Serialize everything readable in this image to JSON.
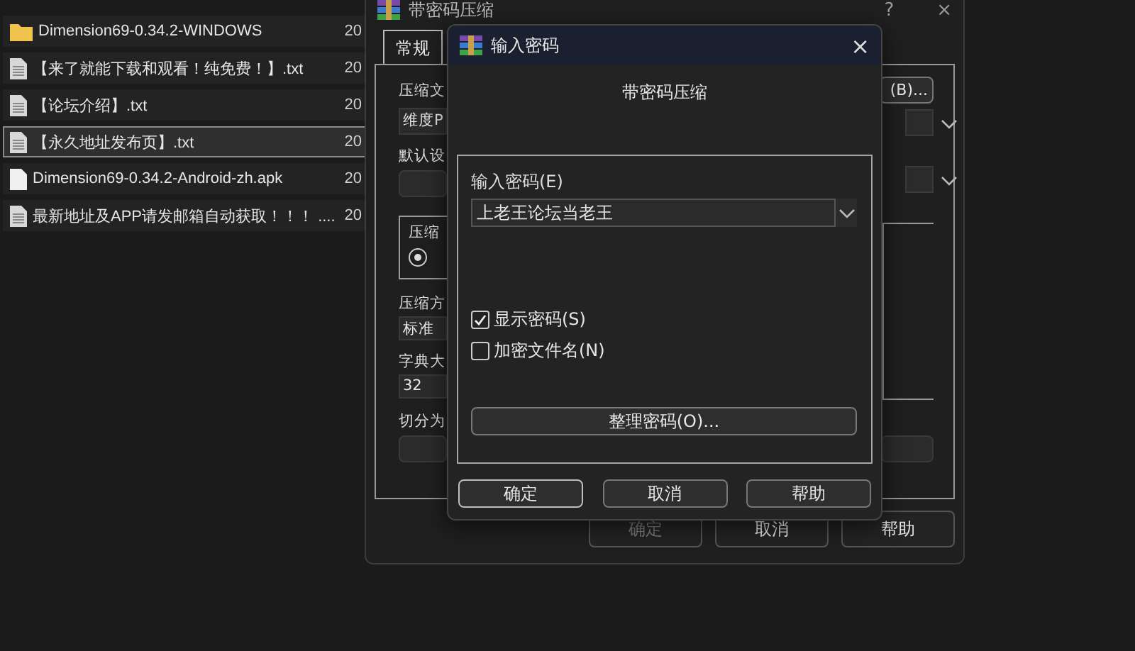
{
  "files": [
    {
      "kind": "folder",
      "name": "Dimension69-0.34.2-WINDOWS",
      "date": "20",
      "selected": false
    },
    {
      "kind": "text",
      "name": "【来了就能下载和观看！纯免费！】.txt",
      "date": "20",
      "selected": false
    },
    {
      "kind": "text",
      "name": "【论坛介绍】.txt",
      "date": "20",
      "selected": false
    },
    {
      "kind": "text",
      "name": "【永久地址发布页】.txt",
      "date": "20",
      "selected": true
    },
    {
      "kind": "file",
      "name": "Dimension69-0.34.2-Android-zh.apk",
      "date": "20",
      "selected": false
    },
    {
      "kind": "text",
      "name": "最新地址及APP请发邮箱自动获取！！！ ....",
      "date": "20",
      "selected": false
    }
  ],
  "archive_window": {
    "title": "带密码压缩",
    "help_glyph": "?",
    "close_glyph": "×",
    "tabs": [
      {
        "label": "常规",
        "selected": true
      }
    ],
    "archive_name_label": "压缩文",
    "archive_name_value": "维度P",
    "browse_button": "(B)...",
    "profile_label": "默认设",
    "format_group_label": "压缩",
    "format_radio_selected": true,
    "method_label": "压缩方",
    "method_value": "标准",
    "dictionary_label": "字典大",
    "dictionary_value": "32",
    "split_label": "切分为",
    "buttons": [
      {
        "label": "确定",
        "disabled": true
      },
      {
        "label": "取消",
        "disabled": false
      },
      {
        "label": "帮助",
        "disabled": false
      }
    ]
  },
  "password_dialog": {
    "title": "输入密码",
    "close_glyph": "×",
    "heading": "带密码压缩",
    "password_label": "输入密码(E)",
    "password_value": "上老王论坛当老王",
    "options": [
      {
        "label": "显示密码(S)",
        "checked": true
      },
      {
        "label": "加密文件名(N)",
        "checked": false
      }
    ],
    "organize_button": "整理密码(O)...",
    "buttons": [
      {
        "label": "确定",
        "default": true
      },
      {
        "label": "取消",
        "default": false
      },
      {
        "label": "帮助",
        "default": false
      }
    ]
  }
}
